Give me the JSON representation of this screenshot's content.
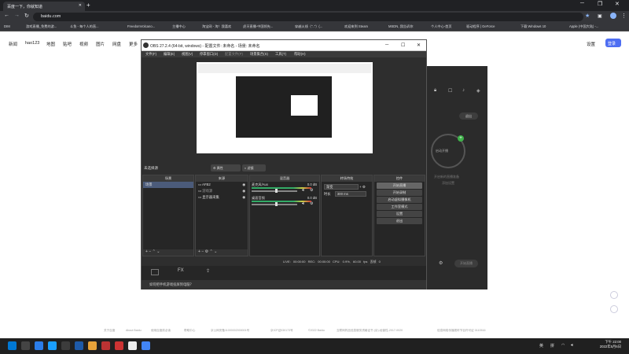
{
  "browser": {
    "tab_title": "百度一下，你就知道",
    "address": "baidu.com",
    "bookmarks": [
      "DIM",
      "游戏直播_免费的游...",
      "斗鱼 - 每个人的直...",
      "FreedomVolcano...",
      "主播中心",
      "淘宝网 - 淘！我喜欢",
      "虎牙直播-中国领先...",
      "穿越火线（\"..\"）(...",
      "欢迎来到 Steam",
      "MSDN, 我告诉你",
      "个人中心-首页",
      "驱动程序 | GeForce",
      "下载 Windows 10",
      "Apple (中国大陆) -..."
    ]
  },
  "baidu": {
    "nav": [
      "新闻",
      "hao123",
      "地图",
      "贴吧",
      "视频",
      "图片",
      "网盘",
      "更多"
    ],
    "settings": "设置",
    "login": "登录",
    "footer": [
      "关于百度",
      "About Baidu",
      "使用百度前必读",
      "帮助中心",
      "京公网安备11000002000001号",
      "京ICP证030173号",
      "©2022 Baidu",
      "互联网药品信息服务资格证书 (京)-经营性-2017-0020",
      "信息网络传播视听节目许可证 0110516"
    ]
  },
  "darkapp": {
    "exit": "退出",
    "circle_label": "启动开播",
    "line1": "开启新的直播准备",
    "line2": "添加设置",
    "start_live": "开始直播"
  },
  "obs": {
    "title": "OBS 27.2.4 (64-bit, windows) - 配置文件: 未命名 - 场景: 未命名",
    "menu": [
      "文件(F)",
      "编辑(E)",
      "视图(V)",
      "停靠窗口(D)",
      "配置文件(P)",
      "场景集合(S)",
      "工具(T)",
      "帮助(H)"
    ],
    "no_source": "未选择源",
    "properties": "属性",
    "filters": "滤镜",
    "docks": {
      "scenes": {
        "title": "场景",
        "items": [
          "场景"
        ]
      },
      "sources": {
        "title": "来源",
        "items": [
          "AFB2",
          "游戏源",
          "显示器采集"
        ]
      },
      "mixer": {
        "title": "混音器",
        "rows": [
          {
            "name": "麦克风/Aux",
            "db": "0.0 dB"
          },
          {
            "name": "桌面音频",
            "db": "0.0 dB"
          }
        ]
      },
      "transitions": {
        "title": "转场特效",
        "type": "渐变",
        "duration_label": "时长",
        "duration": "300 ms"
      },
      "controls": {
        "title": "控件",
        "buttons": [
          "开始直播",
          "开始录制",
          "启动虚拟摄像机",
          "工作室模式",
          "设置",
          "退出"
        ]
      }
    },
    "status": {
      "live": "LIVE: 00:00:00",
      "rec": "REC: 00:00:00",
      "cpu": "CPU: 0.9%, 60.00 fps",
      "dropped": "丢帧 0"
    },
    "notice": "如何把手机游戏投屏到电脑？"
  },
  "taskbar": {
    "lang": "英",
    "ime": "拼",
    "time": "下午 22:00",
    "date": "2022年5月6日"
  }
}
